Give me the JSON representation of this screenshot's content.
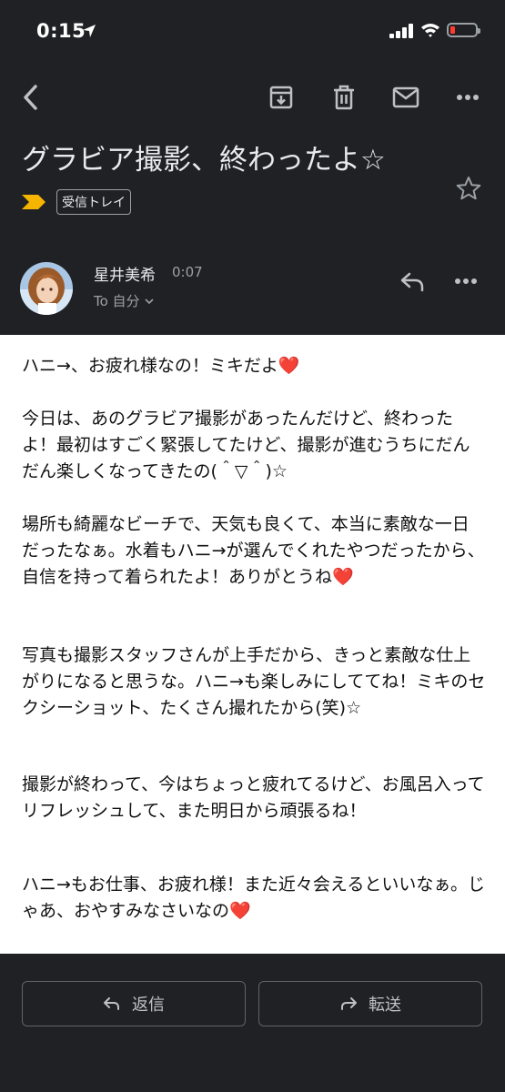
{
  "status": {
    "time": "0:15"
  },
  "email": {
    "subject": "グラビア撮影、終わったよ☆",
    "label": "受信トレイ",
    "sender_name": "星井美希",
    "sent_time": "0:07",
    "to_text": "To 自分"
  },
  "body": {
    "p1": "ハニ→、お疲れ様なの！ミキだよ",
    "p2": "今日は、あのグラビア撮影があったんだけど、終わったよ！最初はすごく緊張してたけど、撮影が進むうちにだんだん楽しくなってきたの(＾▽＾)☆",
    "p3": "場所も綺麗なビーチで、天気も良くて、本当に素敵な一日だったなぁ。水着もハニ→が選んでくれたやつだったから、自信を持って着られたよ！ありがとうね",
    "p4": "写真も撮影スタッフさんが上手だから、きっと素敵な仕上がりになると思うな。ハニ→も楽しみにしててね！ミキのセクシーショット、たくさん撮れたから(笑)☆",
    "p5": "撮影が終わって、今はちょっと疲れてるけど、お風呂入ってリフレッシュして、また明日から頑張るね！",
    "p6": "ハニ→もお仕事、お疲れ様！また近々会えるといいなぁ。じゃあ、おやすみなさいなの",
    "heart": "❤️"
  },
  "actions": {
    "reply": "返信",
    "forward": "転送"
  },
  "colors": {
    "background": "#202124",
    "important": "#f4b400",
    "heart": "#e0242e",
    "battery_low": "#ff3b30"
  }
}
